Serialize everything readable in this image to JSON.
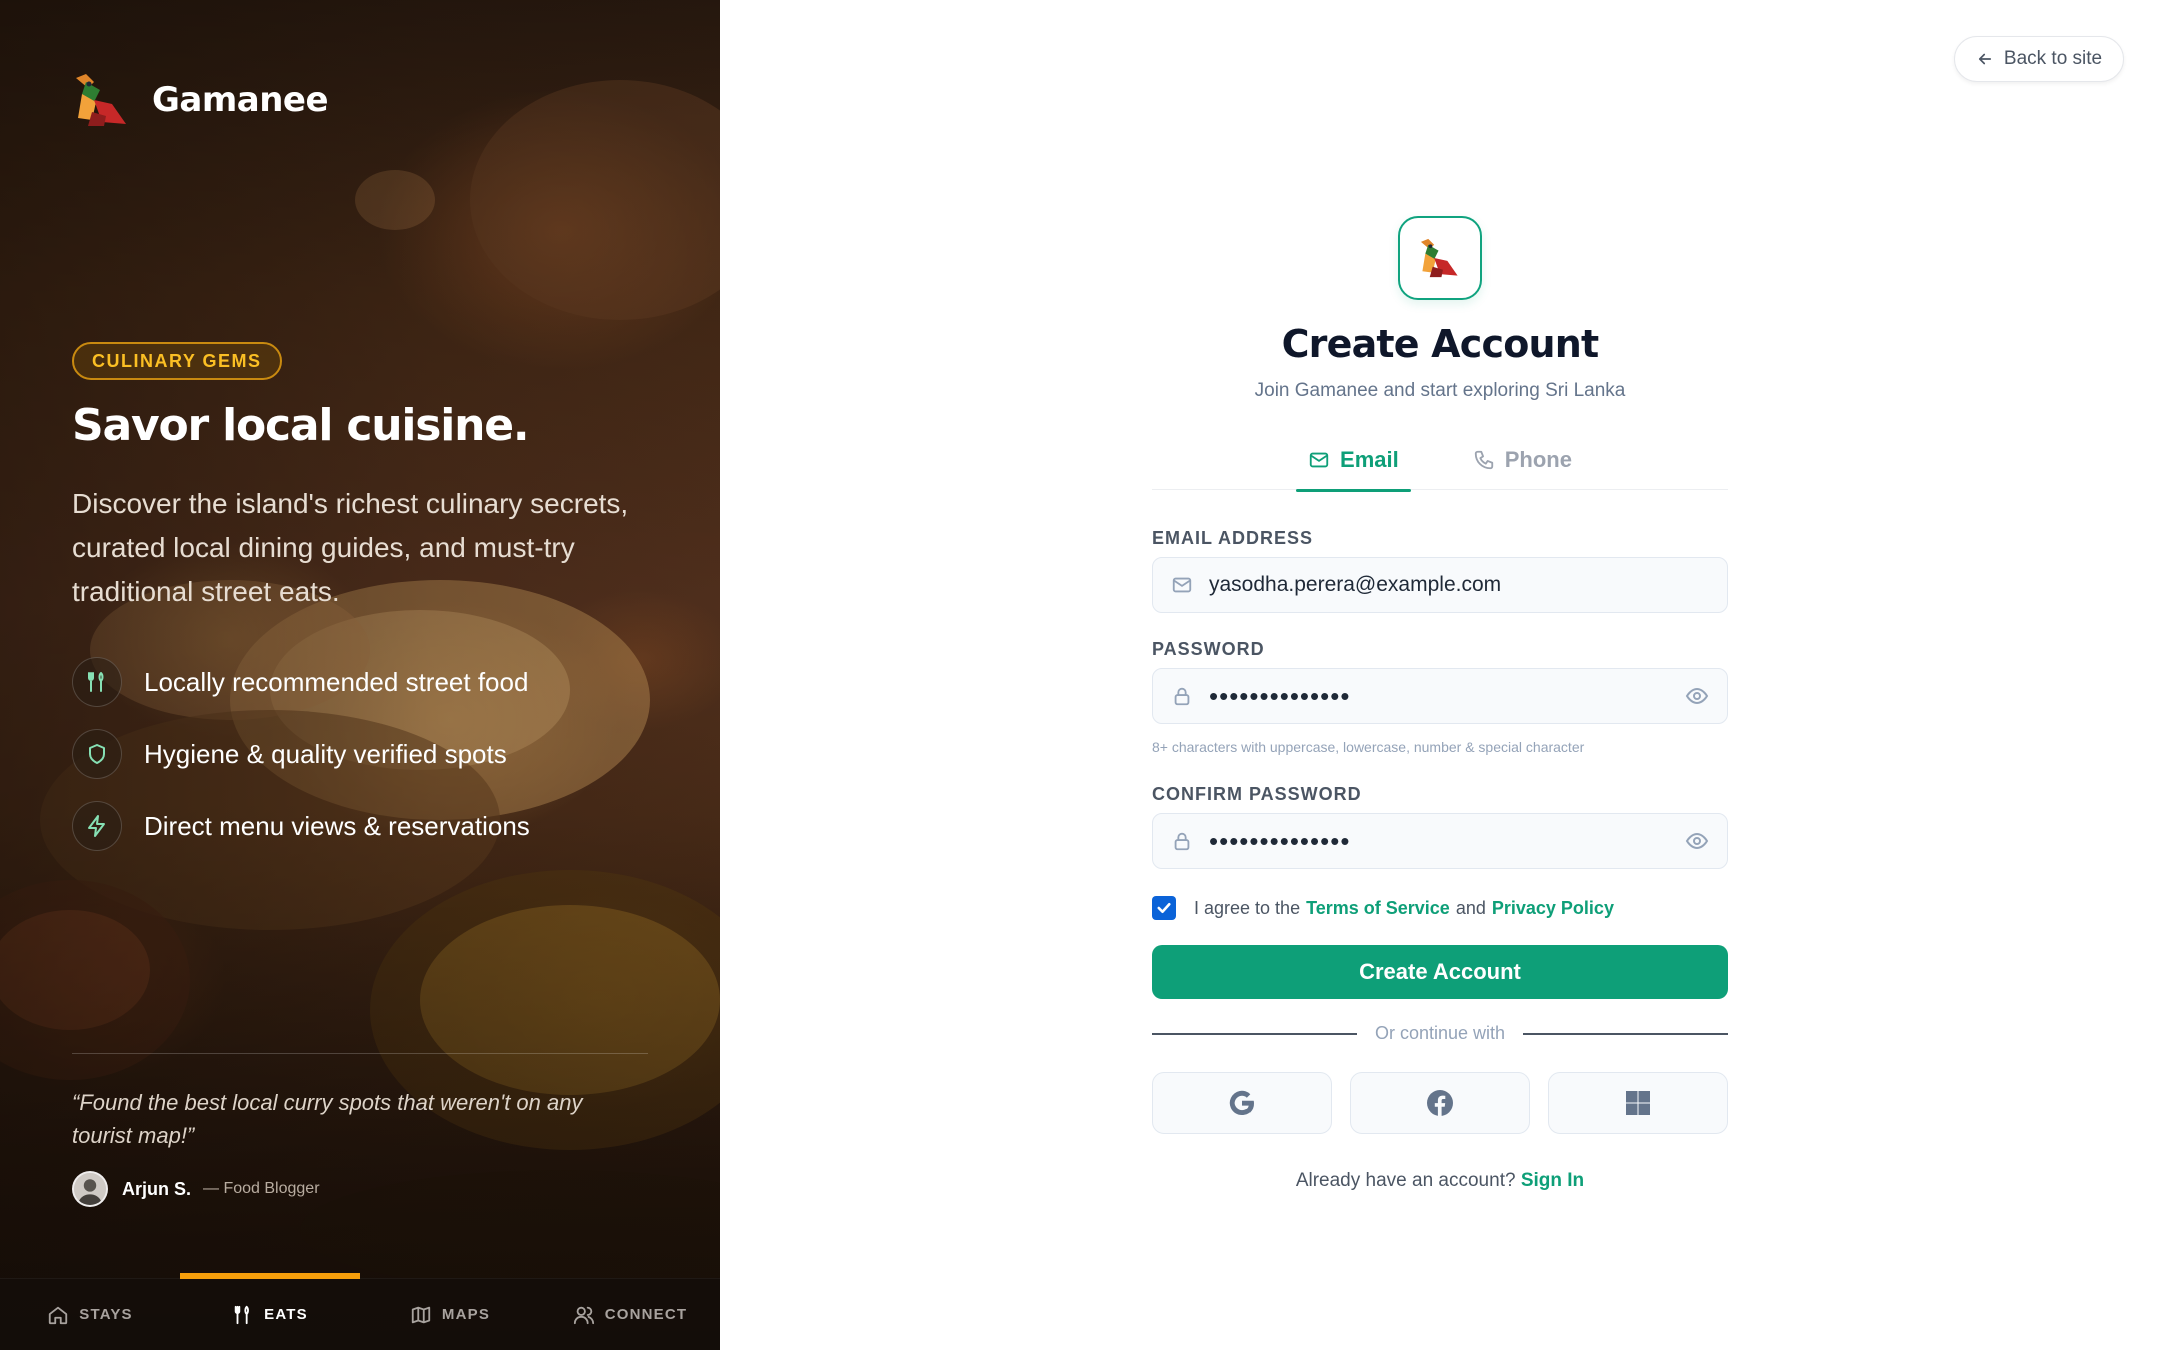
{
  "hero": {
    "brand_name": "Gamanee",
    "badge": "CULINARY GEMS",
    "title": "Savor local cuisine.",
    "description": "Discover the island's richest culinary secrets, curated local dining guides, and must-try traditional street eats.",
    "features": [
      {
        "icon": "utensils-icon",
        "label": "Locally recommended street food"
      },
      {
        "icon": "shield-icon",
        "label": "Hygiene & quality verified spots"
      },
      {
        "icon": "lightning-icon",
        "label": "Direct menu views & reservations"
      }
    ],
    "quote": "“Found the best local curry spots that weren't on any tourist map!”",
    "author_name": "Arjun S.",
    "author_role": "— Food Blogger"
  },
  "bottom_nav": [
    {
      "icon": "home-icon",
      "label": "STAYS",
      "active": false
    },
    {
      "icon": "utensils-icon",
      "label": "EATS",
      "active": true
    },
    {
      "icon": "map-icon",
      "label": "MAPS",
      "active": false
    },
    {
      "icon": "users-icon",
      "label": "CONNECT",
      "active": false
    }
  ],
  "back_button": "Back to site",
  "form": {
    "title": "Create Account",
    "subtitle": "Join Gamanee and start exploring Sri Lanka",
    "tabs": [
      {
        "icon": "mail-icon",
        "label": "Email",
        "active": true
      },
      {
        "icon": "phone-icon",
        "label": "Phone",
        "active": false
      }
    ],
    "email_label": "EMAIL ADDRESS",
    "email_value": "yasodha.perera@example.com",
    "password_label": "PASSWORD",
    "password_value": "••••••••••••••",
    "password_hint": "8+ characters with uppercase, lowercase, number & special character",
    "confirm_label": "CONFIRM PASSWORD",
    "confirm_value": "••••••••••••••",
    "agree_prefix": "I agree to the",
    "terms_link": "Terms of Service",
    "agree_and": "and",
    "privacy_link": "Privacy Policy",
    "agree_checked": true,
    "submit": "Create Account",
    "divider": "Or continue with",
    "socials": [
      "google-icon",
      "facebook-icon",
      "microsoft-icon"
    ],
    "have_account": "Already have an account?",
    "signin_link": "Sign In"
  },
  "colors": {
    "accent": "#0e9f78",
    "badge": "#fbbf24",
    "nav_active": "#f59e0b",
    "checkbox": "#0b63d8"
  }
}
